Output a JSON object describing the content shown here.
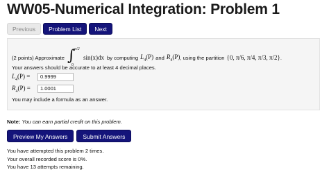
{
  "page": {
    "title": "WW05-Numerical Integration: Problem 1"
  },
  "nav": {
    "previous": "Previous",
    "problem_list": "Problem List",
    "next": "Next"
  },
  "problem": {
    "points": "(2 points) Approximate",
    "upper_limit": "π/2",
    "lower_limit": "0",
    "integrand": "sin(x)dx",
    "by_computing": "by computing",
    "L4": "L",
    "four_a": "4",
    "P_a": "(P)",
    "and": "and",
    "R4": "R",
    "four_b": "4",
    "P_b": "(P)",
    "partition_text": ", using the partition",
    "partition_set": "{0, π/6, π/4, π/3, π/2}",
    "partition_end": "."
  },
  "accuracy_text": "Your answers should be accurate to at least 4 decimal places.",
  "answers": {
    "L_label": "L",
    "L_sub": "4",
    "L_suffix": "(P) =",
    "L_value": "0.9999",
    "R_label": "R",
    "R_sub": "4",
    "R_suffix": "(P) =",
    "R_value": "1.0001"
  },
  "formula_note": "You may include a formula as an answer.",
  "note": {
    "bold": "Note:",
    "italic": "You can earn partial credit on this problem."
  },
  "actions": {
    "preview": "Preview My Answers",
    "submit": "Submit Answers"
  },
  "status": {
    "attempted": "You have attempted this problem 2 times.",
    "score": "Your overall recorded score is 0%.",
    "remaining": "You have 13 attempts remaining."
  },
  "colors": {
    "primary_button": "#14147a",
    "panel": "#f5f5f5"
  }
}
